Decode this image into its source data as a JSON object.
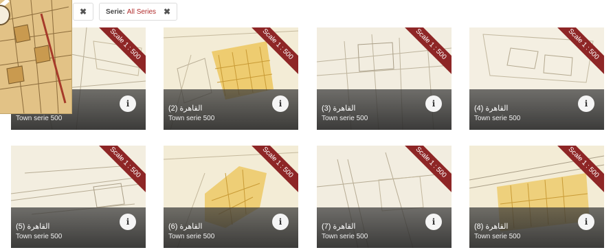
{
  "filters": {
    "close_glyph": "✖",
    "serie_label": "Serie:",
    "serie_value": "All Series"
  },
  "cards": [
    {
      "title": "",
      "series": "Town serie 500",
      "scale": "Scale 1 : 500",
      "info": "i"
    },
    {
      "title": "القاهرة (2)",
      "series": "Town serie 500",
      "scale": "Scale 1 : 500",
      "info": "i"
    },
    {
      "title": "القاهرة (3)",
      "series": "Town serie 500",
      "scale": "Scale 1 : 500",
      "info": "i"
    },
    {
      "title": "القاهرة (4)",
      "series": "Town serie 500",
      "scale": "Scale 1 : 500",
      "info": "i"
    },
    {
      "title": "القاهرة (5)",
      "series": "Town serie 500",
      "scale": "Scale 1 : 500",
      "info": "i"
    },
    {
      "title": "القاهرة (6)",
      "series": "Town serie 500",
      "scale": "Scale 1 : 500",
      "info": "i"
    },
    {
      "title": "القاهرة (7)",
      "series": "Town serie 500",
      "scale": "Scale 1 : 500",
      "info": "i"
    },
    {
      "title": "القاهرة (8)",
      "series": "Town serie 500",
      "scale": "Scale 1 : 500",
      "info": "i"
    }
  ],
  "colors": {
    "ribbon": "#8e2626",
    "map_paper": "#f1ebd9",
    "map_built": "#e9c25a",
    "filter_value": "#b02a2a"
  }
}
